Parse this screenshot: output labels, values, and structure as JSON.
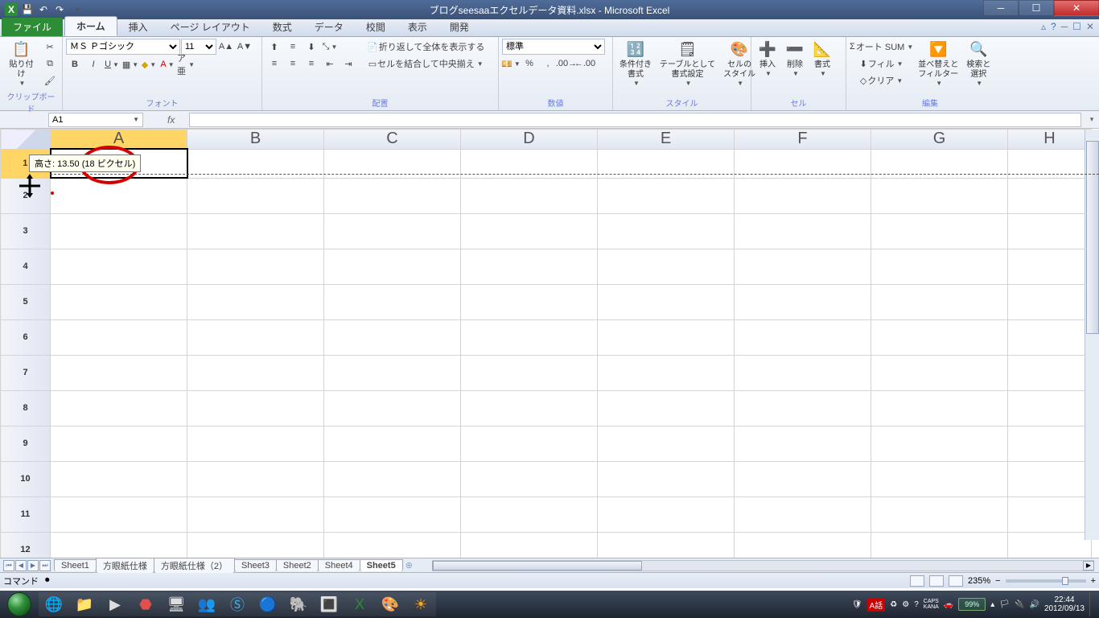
{
  "titlebar": {
    "title": "ブログseesaaエクセルデータ資料.xlsx - Microsoft Excel"
  },
  "tabs": {
    "file": "ファイル",
    "items": [
      "ホーム",
      "挿入",
      "ページ レイアウト",
      "数式",
      "データ",
      "校閲",
      "表示",
      "開発"
    ],
    "active": 0
  },
  "ribbon": {
    "clipboard": {
      "paste": "貼り付け",
      "label": "クリップボード"
    },
    "font": {
      "name": "ＭＳ Ｐゴシック",
      "size": "11",
      "label": "フォント"
    },
    "align": {
      "wrap": "折り返して全体を表示する",
      "merge": "セルを結合して中央揃え",
      "label": "配置"
    },
    "number": {
      "format": "標準",
      "label": "数値"
    },
    "styles": {
      "cond": "条件付き\n書式",
      "table": "テーブルとして\n書式設定",
      "cell": "セルの\nスタイル",
      "label": "スタイル"
    },
    "cells": {
      "insert": "挿入",
      "delete": "削除",
      "format": "書式",
      "label": "セル"
    },
    "editing": {
      "autosum": "オート SUM",
      "fill": "フィル",
      "clear": "クリア",
      "sort": "並べ替えと\nフィルター",
      "find": "検索と\n選択",
      "label": "編集"
    }
  },
  "fbar": {
    "namebox": "A1",
    "fx": "fx"
  },
  "grid": {
    "cols": [
      "A",
      "B",
      "C",
      "D",
      "E",
      "F",
      "G",
      "H"
    ],
    "rows": [
      "1",
      "2",
      "3",
      "4",
      "5",
      "6",
      "7",
      "8",
      "9",
      "10",
      "11",
      "12"
    ],
    "tooltip": "高さ: 13.50 (18 ピクセル)"
  },
  "sheettabs": {
    "tabs": [
      "Sheet1",
      "方眼紙仕様",
      "方眼紙仕様（2）",
      "Sheet3",
      "Sheet2",
      "Sheet4",
      "Sheet5"
    ],
    "active": 6
  },
  "statusbar": {
    "mode": "コマンド",
    "zoom": "235%"
  },
  "taskbar": {
    "lang": "A話",
    "caps": "CAPS",
    "kana": "KANA",
    "battery": "99%",
    "time": "22:44",
    "date": "2012/09/13"
  }
}
